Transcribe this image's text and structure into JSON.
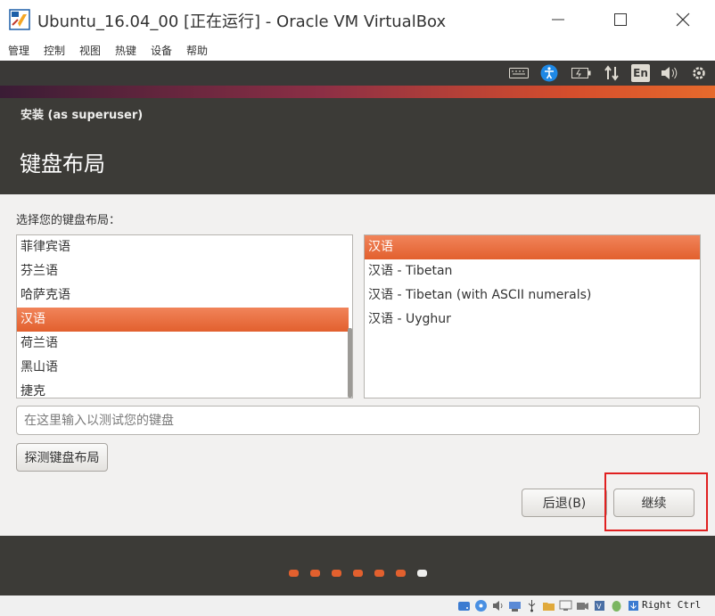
{
  "window": {
    "title": "Ubuntu_16.04_00 [正在运行] - Oracle VM VirtualBox",
    "menu": [
      "管理",
      "控制",
      "视图",
      "热键",
      "设备",
      "帮助"
    ]
  },
  "panel": {
    "lang_indicator": "En",
    "icons": [
      "keyboard-icon",
      "accessibility-icon",
      "battery-icon",
      "network-icon",
      "language-icon",
      "volume-icon",
      "power-gear-icon"
    ]
  },
  "dialog": {
    "subtitle": "安装 (as superuser)",
    "title": "键盘布局",
    "prompt": "选择您的键盘布局：",
    "layouts": [
      "菲律宾语",
      "芬兰语",
      "哈萨克语",
      "汉语",
      "荷兰语",
      "黑山语",
      "捷克"
    ],
    "layouts_selected_index": 3,
    "variants": [
      "汉语",
      "汉语 - Tibetan",
      "汉语 - Tibetan (with ASCII numerals)",
      "汉语 - Uyghur"
    ],
    "variants_selected_index": 0,
    "test_placeholder": "在这里输入以测试您的键盘",
    "detect_button": "探测键盘布局",
    "back_button": "后退(B)",
    "continue_button": "继续",
    "progress": {
      "total_steps": 7,
      "current_step": 7
    }
  },
  "statusbar": {
    "host_key": "Right Ctrl"
  },
  "colors": {
    "accent": "#e2602e",
    "dialog_dark": "#3c3b37",
    "highlight_box": "#e02020"
  }
}
